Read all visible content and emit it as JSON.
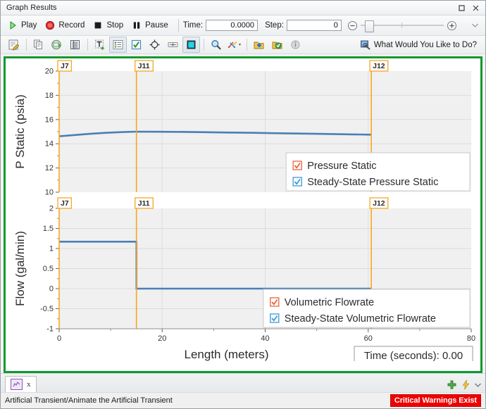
{
  "window": {
    "title": "Graph Results",
    "restore_label": "❐",
    "close_label": "✕"
  },
  "transport": {
    "play_label": "Play",
    "record_label": "Record",
    "stop_label": "Stop",
    "pause_label": "Pause",
    "time_label": "Time:",
    "time_value": "0.0000",
    "step_label": "Step:",
    "step_value": "0",
    "zoom_out_icon": "minus-circle-icon",
    "zoom_in_icon": "plus-circle-icon",
    "overflow_icon": "chevron-down-icon"
  },
  "icon_toolbar": {
    "icons": [
      "edit-graph-icon",
      "copy-icon",
      "save-graph-icon",
      "view-table-icon",
      "add-text-icon",
      "graph-list-manager-icon",
      "show-checkmarks-icon",
      "crosshair-icon",
      "annotate-icon",
      "color-fill-icon",
      "zoom-icon",
      "graph-style-icon",
      "add-graph-icon",
      "load-graph-icon",
      "info-icon"
    ],
    "help_label": "What Would You Like to Do?",
    "help_icon": "what-would-you-like-to-do-icon"
  },
  "chart_data": {
    "type": "line",
    "title": "",
    "xlabel": "Length (meters)",
    "xlim": [
      0,
      80
    ],
    "xticks": [
      0,
      20,
      40,
      60,
      80
    ],
    "grid": true,
    "markers": [
      {
        "label": "J7",
        "x": 0
      },
      {
        "label": "J11",
        "x": 15
      },
      {
        "label": "J12",
        "x": 60.6
      }
    ],
    "panels": [
      {
        "ylabel": "P Static (psia)",
        "ylim": [
          10,
          20
        ],
        "yticks": [
          10,
          12,
          14,
          16,
          18,
          20
        ],
        "legend": [
          {
            "label": "Pressure Static",
            "color": "#e8633a",
            "checked": true
          },
          {
            "label": "Steady-State Pressure Static",
            "color": "#3b9ad9",
            "checked": true
          }
        ],
        "series": [
          {
            "name": "Steady-State Pressure Static",
            "color": "#4a7fb5",
            "x": [
              0,
              3,
              6,
              9,
              12,
              15,
              20,
              26,
              32,
              38,
              44,
              50,
              56,
              60.6
            ],
            "y": [
              14.62,
              14.72,
              14.82,
              14.9,
              14.96,
              15.0,
              14.99,
              14.97,
              14.93,
              14.9,
              14.86,
              14.82,
              14.78,
              14.75
            ]
          }
        ]
      },
      {
        "ylabel": "Flow (gal/min)",
        "ylim": [
          -1,
          2
        ],
        "yticks": [
          -1,
          -0.5,
          0,
          0.5,
          1,
          1.5,
          2
        ],
        "ytick_labels": [
          "-1",
          "-0.5",
          "0",
          "0.5",
          "1",
          "1.5",
          "2"
        ],
        "legend": [
          {
            "label": "Volumetric Flowrate",
            "color": "#e8633a",
            "checked": true
          },
          {
            "label": "Steady-State Volumetric Flowrate",
            "color": "#3b9ad9",
            "checked": true
          }
        ],
        "series": [
          {
            "name": "Steady-State Volumetric Flowrate",
            "color": "#4a7fb5",
            "x": [
              0,
              15,
              15,
              60.6
            ],
            "y": [
              1.17,
              1.17,
              0.0,
              0.0
            ]
          }
        ]
      }
    ],
    "time_readout": "Time (seconds): 0.00"
  },
  "tabs": {
    "items": [
      {
        "label": "",
        "icon": "graph-tab-icon",
        "close_label": "x"
      }
    ],
    "add_icon": "add-plus-icon",
    "bolt_icon": "lightning-bolt-icon",
    "dropdown_icon": "chevron-down-icon"
  },
  "status": {
    "text": "Artificial Transient/Animate the Artificial Transient",
    "warning": "Critical Warnings Exist",
    "warning_color": "#ee0000"
  }
}
